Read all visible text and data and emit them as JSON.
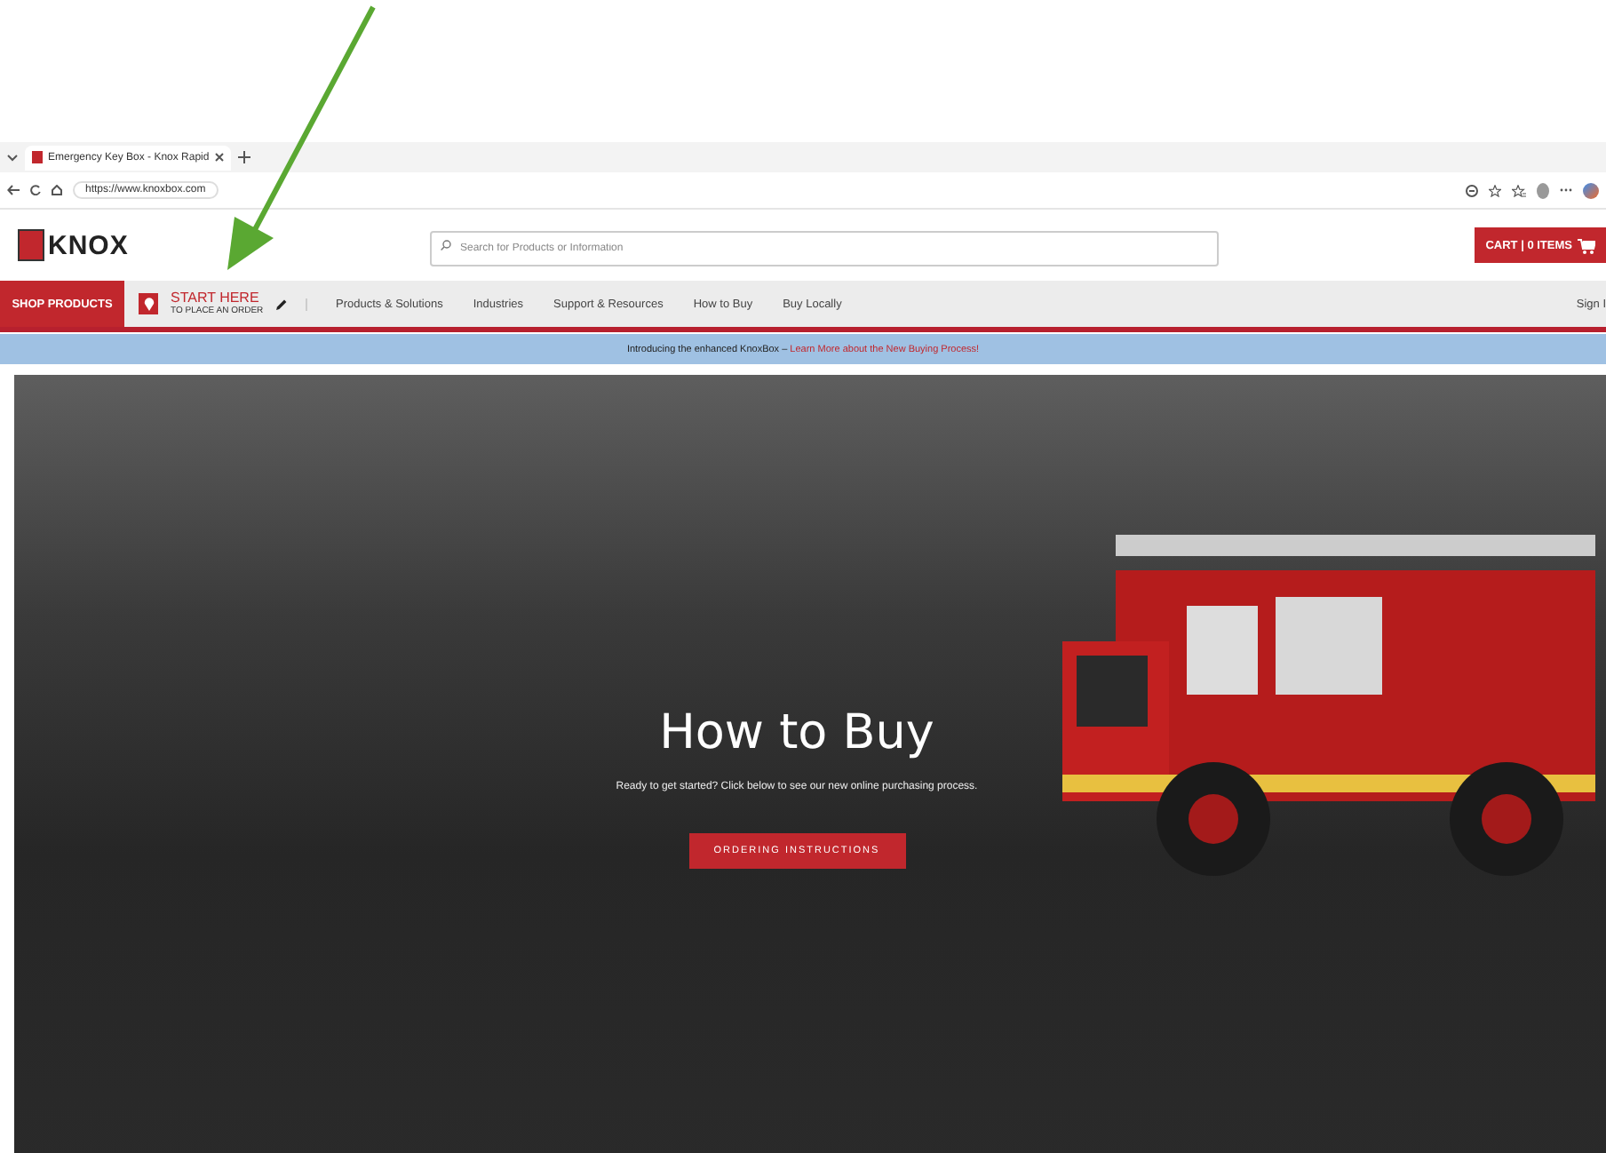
{
  "browser": {
    "tab_title": "Emergency Key Box - Knox Rapid",
    "url": "https://www.knoxbox.com"
  },
  "header": {
    "logo": "KNOX",
    "search": {
      "placeholder": "Search for Products or Information"
    },
    "cart": "CART | 0 ITEMS"
  },
  "nav": {
    "shop_products": "SHOP PRODUCTS",
    "start_here": {
      "title": "START HERE",
      "subtitle": "TO PLACE AN ORDER"
    },
    "items": [
      "Products & Solutions",
      "Industries",
      "Support & Resources",
      "How to Buy",
      "Buy Locally"
    ],
    "sign_in": "Sign I"
  },
  "banner": {
    "text": "Introducing the enhanced KnoxBox – ",
    "link": "Learn More about the New Buying Process!"
  },
  "hero": {
    "title": "How to Buy",
    "subtitle": "Ready to get started? Click below to see our new online purchasing process.",
    "button": "ORDERING INSTRUCTIONS"
  }
}
